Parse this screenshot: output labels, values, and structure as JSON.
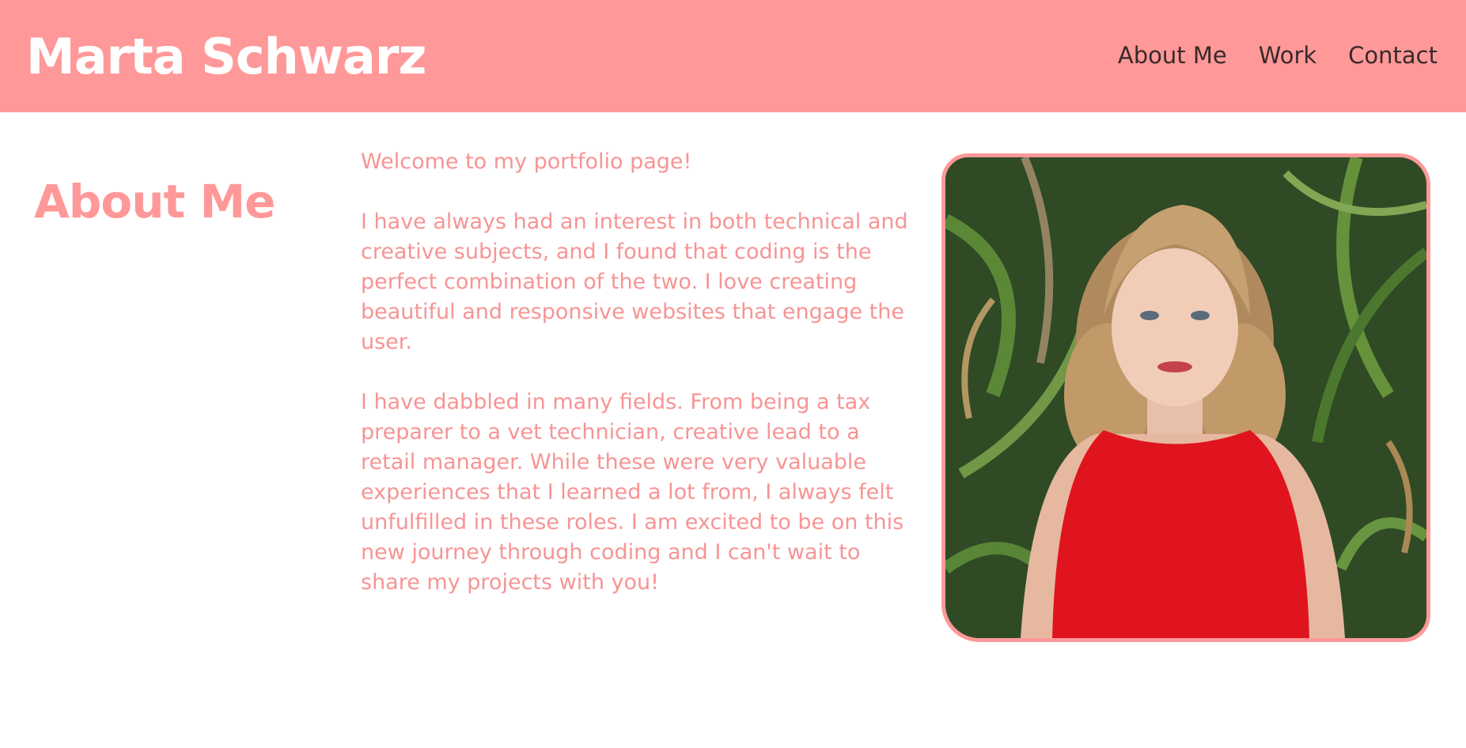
{
  "header": {
    "site_title": "Marta Schwarz",
    "nav": [
      {
        "label": "About Me"
      },
      {
        "label": "Work"
      },
      {
        "label": "Contact"
      }
    ]
  },
  "about": {
    "heading": "About Me",
    "paragraphs": [
      "Welcome to my portfolio page!",
      "I have always had an interest in both technical and creative subjects, and I found that coding is the perfect combination of the two. I love creating beautiful and responsive websites that engage the user.",
      "I have dabbled in many fields. From being a tax preparer to a vet technician, creative lead to a retail manager. While these were very valuable experiences that I learned a lot from, I always felt unfulfilled in these roles. I am excited to be on this new journey through coding and I can't wait to share my projects with you!"
    ]
  },
  "colors": {
    "accent": "#ff9898",
    "header_bg": "#ff9898",
    "nav_text": "#3a2a2a",
    "title_text": "#ffffff",
    "body_text": "#f79494"
  },
  "photo": {
    "icon": "portrait-photo"
  }
}
